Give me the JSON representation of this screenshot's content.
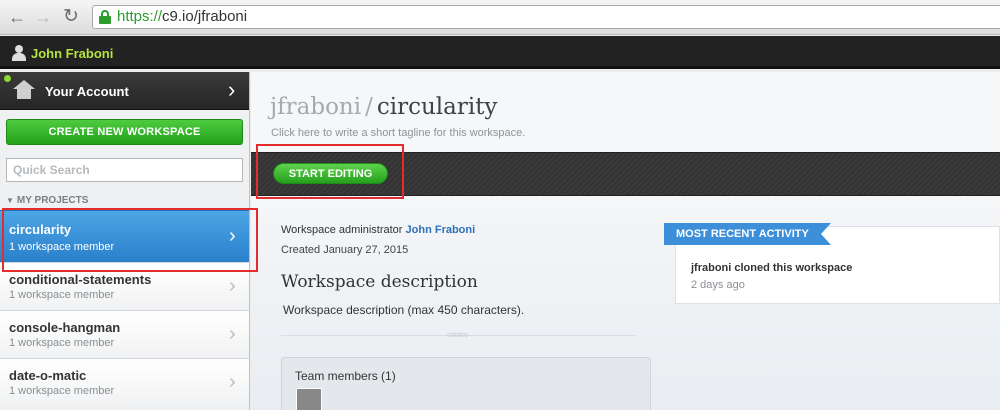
{
  "browser": {
    "url_scheme": "https://",
    "url_rest": "c9.io/jfraboni",
    "back_icon": "back-arrow-icon",
    "forward_icon": "forward-arrow-icon",
    "reload_icon": "reload-icon",
    "lock_icon": "lock-icon"
  },
  "topbar": {
    "user_name": "John Fraboni",
    "user_icon": "user-icon"
  },
  "sidebar": {
    "account_label": "Your Account",
    "create_button": "CREATE NEW WORKSPACE",
    "search_placeholder": "Quick Search",
    "projects_header": "MY PROJECTS",
    "projects": [
      {
        "name": "circularity",
        "meta": "1 workspace member",
        "active": true
      },
      {
        "name": "conditional-statements",
        "meta": "1 workspace member",
        "active": false
      },
      {
        "name": "console-hangman",
        "meta": "1 workspace member",
        "active": false
      },
      {
        "name": "date-o-matic",
        "meta": "1 workspace member",
        "active": false
      }
    ]
  },
  "workspace": {
    "owner": "jfraboni",
    "separator": "/",
    "name": "circularity",
    "tagline": "Click here to write a short tagline for this workspace.",
    "start_button": "START EDITING",
    "admin_label": "Workspace administrator",
    "admin_name": "John Fraboni",
    "created": "Created January 27, 2015",
    "description_heading": "Workspace description",
    "description_text": "Workspace description (max 450 characters).",
    "team_label": "Team members (1)"
  },
  "activity": {
    "title": "MOST RECENT ACTIVITY",
    "text": "jfraboni cloned this workspace",
    "time": "2 days ago"
  },
  "colors": {
    "accent_green": "#22a11a",
    "accent_blue": "#2a7fcb",
    "annotation_red": "#e32d2d"
  }
}
